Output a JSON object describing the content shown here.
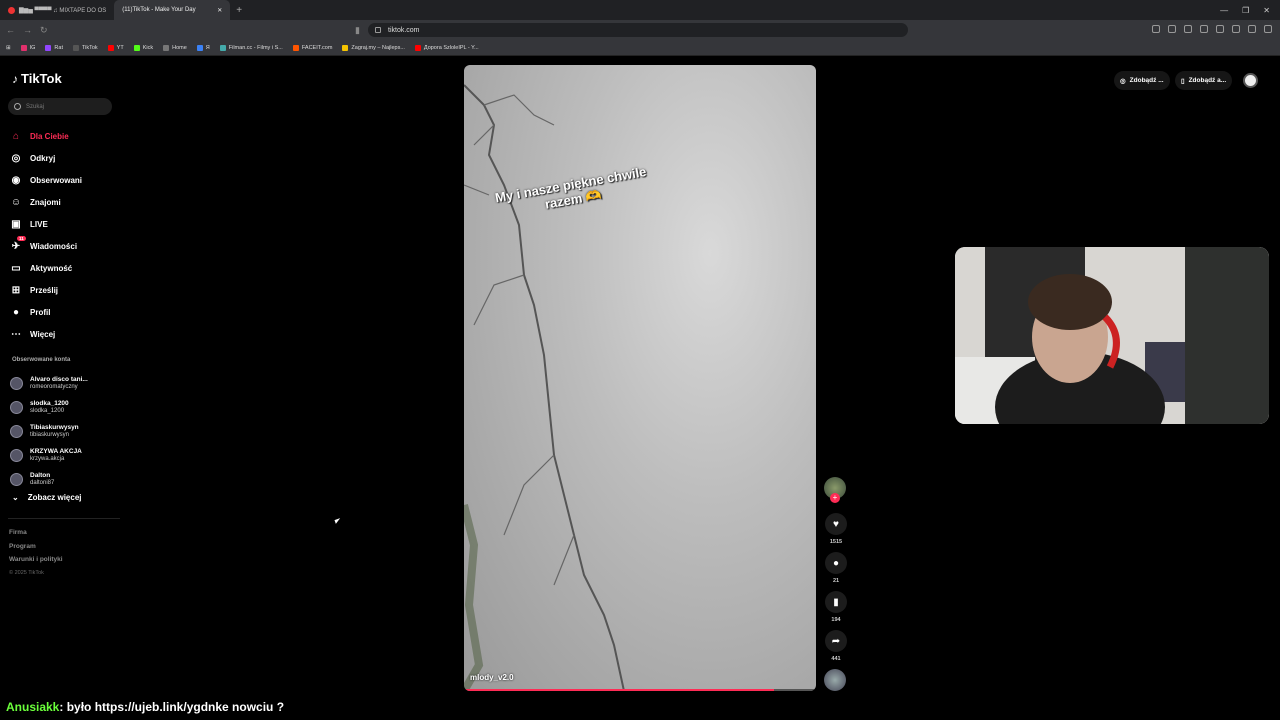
{
  "browser": {
    "tabs": [
      {
        "label": "▇▆▅ ▀▀▀▀ ♫ MIXTAPE DO OS",
        "active": false
      },
      {
        "label": "(11)TikTok - Make Your Day",
        "active": true
      }
    ],
    "url": "tiktok.com",
    "bookmarks": [
      {
        "label": "IG",
        "color": "#e1306c"
      },
      {
        "label": "Rat",
        "color": "#9146ff"
      },
      {
        "label": "TikTok",
        "color": "#111111"
      },
      {
        "label": "YT",
        "color": "#ff0000"
      },
      {
        "label": "Kick",
        "color": "#53fc18"
      },
      {
        "label": "Home",
        "color": "#222222"
      },
      {
        "label": "Я",
        "color": "#3b82f6"
      },
      {
        "label": "Filman.cc - Filmy i S...",
        "color": "#4aa"
      },
      {
        "label": "FACEIT.com",
        "color": "#ff5500"
      },
      {
        "label": "Zagraj.my – Najleps...",
        "color": "#f5c400"
      },
      {
        "label": "Дорога SzloleIPL - Y...",
        "color": "#ff0000"
      }
    ]
  },
  "sidebar": {
    "logo": "TikTok",
    "search_placeholder": "Szukaj",
    "nav": [
      {
        "label": "Dla Ciebie",
        "icon": "home-icon",
        "glyph": "⌂",
        "active": true
      },
      {
        "label": "Odkryj",
        "icon": "compass-icon",
        "glyph": "◎"
      },
      {
        "label": "Obserwowani",
        "icon": "following-icon",
        "glyph": "◉"
      },
      {
        "label": "Znajomi",
        "icon": "friends-icon",
        "glyph": "☺"
      },
      {
        "label": "LIVE",
        "icon": "live-icon",
        "glyph": "▣"
      },
      {
        "label": "Wiadomości",
        "icon": "messages-icon",
        "glyph": "✈",
        "badge": "11"
      },
      {
        "label": "Aktywność",
        "icon": "activity-icon",
        "glyph": "▭"
      },
      {
        "label": "Prześlij",
        "icon": "upload-icon",
        "glyph": "⊞"
      },
      {
        "label": "Profil",
        "icon": "profile-icon",
        "glyph": "●"
      },
      {
        "label": "Więcej",
        "icon": "more-icon",
        "glyph": "⋯"
      }
    ],
    "following_header": "Obserwowane konta",
    "following": [
      {
        "name": "Alvaro disco tani...",
        "handle": "romeoromatyczny"
      },
      {
        "name": "slodka_1200",
        "handle": "slodka_1200"
      },
      {
        "name": "Tibiaskurwysyn",
        "handle": "tibiaskurwysyn"
      },
      {
        "name": "KRZYWA AKCJA",
        "handle": "krzywa.akcja"
      },
      {
        "name": "Dalton",
        "handle": "daltoni87"
      }
    ],
    "see_more": "Zobacz więcej",
    "footer": [
      "Firma",
      "Program",
      "Warunki i polityki"
    ],
    "copyright": "© 2025 TikTok"
  },
  "topright": {
    "btn1": "Zdobądź ...",
    "btn2": "Zdobądź a..."
  },
  "video": {
    "caption": "My i nasze piękne chwile razem 🫶",
    "author": "mlody_v2.0",
    "progress": 0.88,
    "likes": "1515",
    "comments": "21",
    "saves": "194",
    "shares": "441"
  },
  "chat": {
    "user": "Anusiakk",
    "message": ": było https://ujeb.link/ygdnke nowciu ?"
  }
}
